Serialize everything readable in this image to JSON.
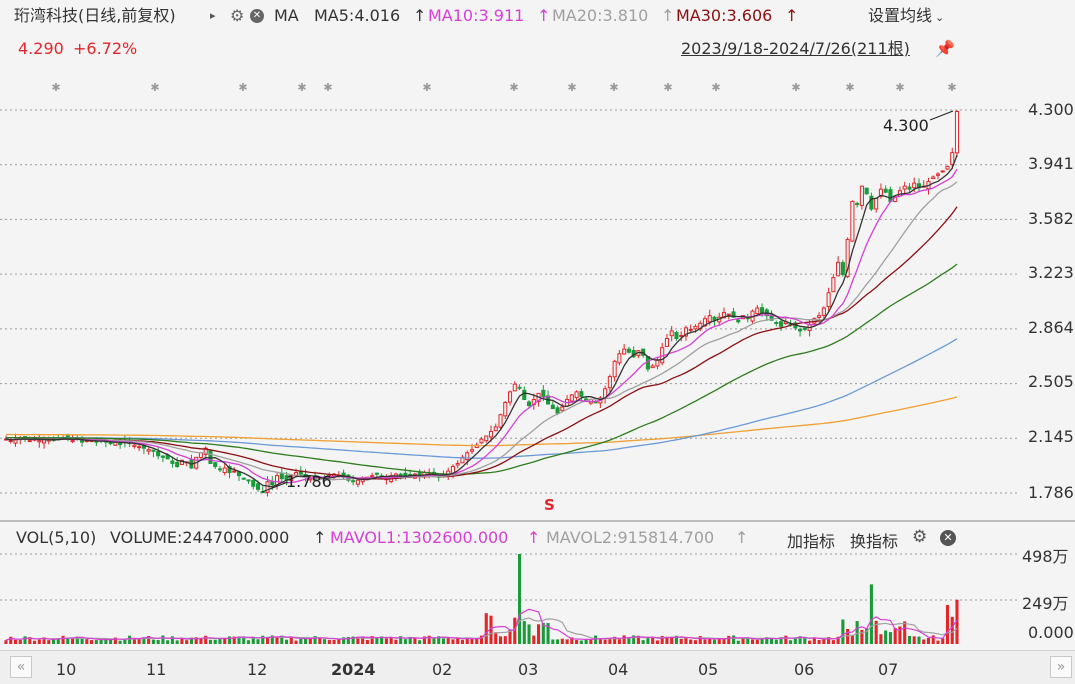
{
  "header": {
    "stock_name": "珩湾科技",
    "period_mode": "(日线,前复权)",
    "ma_label": "MA",
    "ma5": "MA5:4.016",
    "ma10": "MA10:3.911",
    "ma20": "MA20:3.810",
    "ma30": "MA30:3.606",
    "settings": "设置均线",
    "price": "4.290",
    "change": "+6.72%",
    "range": "2023/9/18-2024/7/26(211根)"
  },
  "price_axis": [
    "4.300",
    "3.941",
    "3.582",
    "3.223",
    "2.864",
    "2.505",
    "2.145",
    "1.786"
  ],
  "annotations": {
    "high": "4.300",
    "low": "1.786",
    "marker": "S"
  },
  "volume_panel": {
    "vol": "VOL(5,10)",
    "volume": "VOLUME:2447000.000",
    "mavol1": "MAVOL1:1302600.000",
    "mavol2": "MAVOL2:915814.700",
    "add_indicator": "加指标",
    "switch_indicator": "换指标",
    "axis": [
      "498万",
      "249万",
      "0.000"
    ]
  },
  "x_axis": [
    "10",
    "11",
    "12",
    "2024",
    "02",
    "03",
    "04",
    "05",
    "06",
    "07"
  ],
  "colors": {
    "up": "#e1262a",
    "down": "#1a9a3a",
    "ma5": "#333333",
    "ma10": "#d63fd6",
    "ma20": "#a0a0a0",
    "ma30": "#8b1010",
    "ma60": "#2e7d1e",
    "ma120": "#6a9bd8",
    "ma250": "#f0a030"
  },
  "chart_data": {
    "type": "candlestick",
    "x_range": [
      "2023/9/18",
      "2024/7/26"
    ],
    "bars": 211,
    "ylim": [
      1.786,
      4.3
    ],
    "last": {
      "close": 4.29,
      "change_pct": 6.72
    },
    "close_series": [
      2.14,
      2.13,
      2.14,
      2.15,
      2.14,
      2.13,
      2.14,
      2.13,
      2.14,
      2.14,
      2.13,
      2.14,
      2.15,
      2.14,
      2.13,
      2.14,
      2.12,
      2.13,
      2.13,
      2.12,
      2.13,
      2.12,
      2.11,
      2.12,
      2.11,
      2.12,
      2.11,
      2.1,
      2.09,
      2.08,
      2.07,
      2.06,
      2.03,
      2.02,
      2.01,
      1.98,
      1.96,
      2.0,
      1.99,
      1.95,
      2.02,
      2.05,
      2.08,
      1.98,
      1.96,
      1.94,
      1.95,
      1.92,
      1.93,
      1.9,
      1.88,
      1.87,
      1.83,
      1.81,
      1.79,
      1.86,
      1.84,
      1.9,
      1.88,
      1.87,
      1.9,
      1.92,
      1.91,
      1.89,
      1.88,
      1.87,
      1.89,
      1.88,
      1.9,
      1.91,
      1.9,
      1.89,
      1.87,
      1.86,
      1.87,
      1.88,
      1.89,
      1.9,
      1.91,
      1.89,
      1.88,
      1.9,
      1.91,
      1.9,
      1.89,
      1.9,
      1.91,
      1.9,
      1.92,
      1.91,
      1.9,
      1.89,
      1.9,
      1.93,
      1.96,
      1.98,
      2.02,
      2.05,
      2.07,
      2.1,
      2.14,
      2.16,
      2.19,
      2.22,
      2.3,
      2.38,
      2.45,
      2.5,
      2.48,
      2.4,
      2.36,
      2.4,
      2.44,
      2.42,
      2.37,
      2.34,
      2.31,
      2.35,
      2.4,
      2.43,
      2.45,
      2.42,
      2.39,
      2.4,
      2.38,
      2.41,
      2.47,
      2.55,
      2.65,
      2.7,
      2.73,
      2.71,
      2.68,
      2.72,
      2.69,
      2.6,
      2.62,
      2.66,
      2.74,
      2.8,
      2.85,
      2.8,
      2.82,
      2.87,
      2.86,
      2.88,
      2.9,
      2.93,
      2.95,
      2.92,
      2.94,
      2.97,
      2.96,
      2.94,
      2.91,
      2.95,
      2.93,
      2.98,
      3.0,
      2.97,
      2.95,
      2.92,
      2.9,
      2.88,
      2.91,
      2.89,
      2.87,
      2.85,
      2.86,
      2.89,
      2.93,
      2.95,
      3.0,
      3.1,
      3.2,
      3.3,
      3.22,
      3.45,
      3.7,
      3.68,
      3.8,
      3.75,
      3.65,
      3.72,
      3.78,
      3.76,
      3.7,
      3.73,
      3.77,
      3.8,
      3.78,
      3.82,
      3.79,
      3.8,
      3.83,
      3.86,
      3.88,
      3.9,
      3.93,
      4.02,
      4.29
    ],
    "ma_lines": [
      "MA5",
      "MA10",
      "MA20",
      "MA30",
      "MA60",
      "MA120",
      "MA250"
    ],
    "volume_axis_max": "498万"
  }
}
